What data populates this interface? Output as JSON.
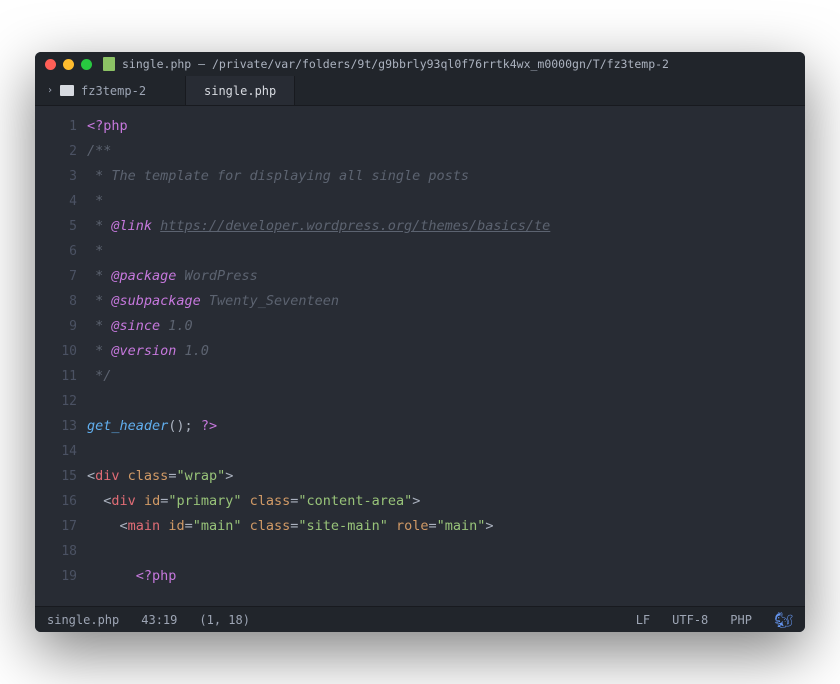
{
  "window": {
    "title": "single.php — /private/var/folders/9t/g9bbrly93ql0f76rrtk4wx_m0000gn/T/fz3temp-2"
  },
  "tree": {
    "root_label": "fz3temp-2"
  },
  "tab": {
    "label": "single.php"
  },
  "gutter": {
    "numbers": [
      "1",
      "2",
      "3",
      "4",
      "5",
      "6",
      "7",
      "8",
      "9",
      "10",
      "11",
      "12",
      "13",
      "14",
      "15",
      "16",
      "17",
      "18",
      "19"
    ]
  },
  "code": {
    "l1_open": "<?php",
    "l2": "/**",
    "l3": " * The template for displaying all single posts",
    "l4": " *",
    "l5_pre": " * ",
    "l5_tag": "@link",
    "l5_link": "https://developer.wordpress.org/themes/basics/te",
    "l6": " *",
    "l7_pre": " * ",
    "l7_tag": "@package",
    "l7_val": " WordPress",
    "l8_pre": " * ",
    "l8_tag": "@subpackage",
    "l8_val": " Twenty_Seventeen",
    "l9_pre": " * ",
    "l9_tag": "@since",
    "l9_val": " 1.0",
    "l10_pre": " * ",
    "l10_tag": "@version",
    "l10_val": " 1.0",
    "l11": " */",
    "l12": "",
    "l13_fn": "get_header",
    "l13_paren": "()",
    "l13_semi": "; ",
    "l13_close": "?>",
    "l14": "",
    "l15_lt": "<",
    "l15_tag": "div",
    "l15_attr_class": "class",
    "l15_eq": "=",
    "l15_q_open": "\"",
    "l15_val_wrap": "wrap",
    "l15_q_close": "\"",
    "l15_gt": ">",
    "l16_indent": "  ",
    "l16_lt": "<",
    "l16_tag": "div",
    "l16_attr_id": "id",
    "l16_eq": "=",
    "l16_q_open": "\"",
    "l16_val_primary": "primary",
    "l16_q_close": "\"",
    "l16_attr_class": "class",
    "l16_val_ca": "content-area",
    "l16_gt": ">",
    "l17_indent": "    ",
    "l17_lt": "<",
    "l17_tag": "main",
    "l17_attr_id": "id",
    "l17_val_main": "main",
    "l17_attr_class": "class",
    "l17_val_sm": "site-main",
    "l17_attr_role": "role",
    "l17_val_role": "main",
    "l17_gt": ">",
    "l18": "",
    "l19_indent": "      ",
    "l19_open": "<?php"
  },
  "status": {
    "filename": "single.php",
    "size": "43:19",
    "pos": "(1, 18)",
    "eol": "LF",
    "enc": "UTF-8",
    "lang": "PHP"
  }
}
